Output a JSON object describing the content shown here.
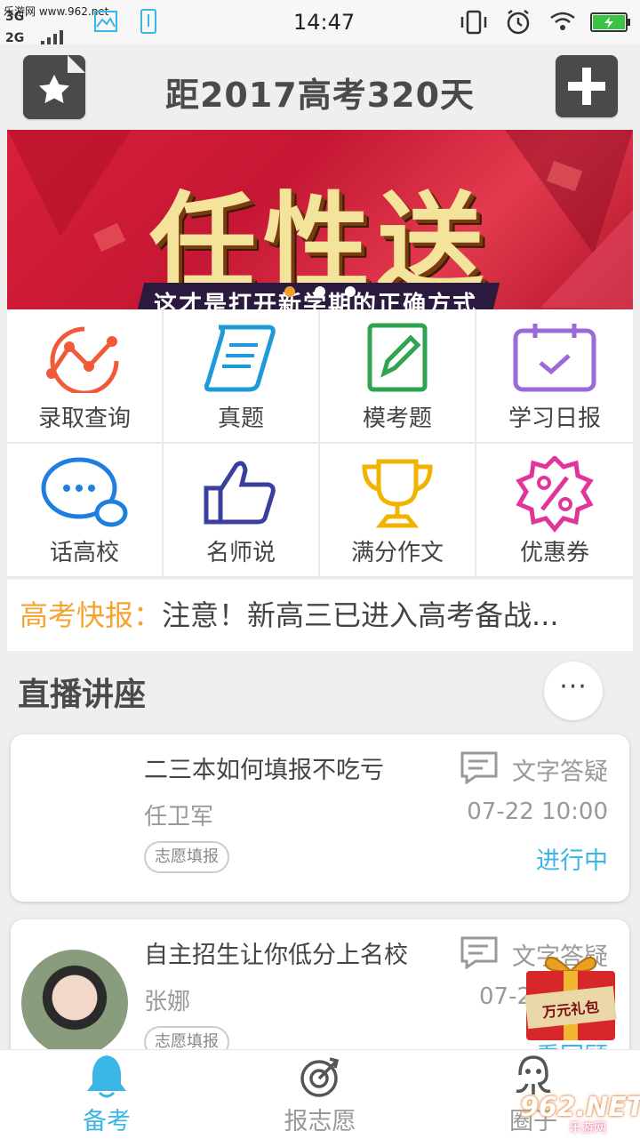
{
  "status_bar": {
    "watermark": "乐游网 www.962.net",
    "net_top": "3G",
    "net_bottom": "2G",
    "time": "14:47"
  },
  "header": {
    "title": "距2017高考320天"
  },
  "banner": {
    "headline": "任性送",
    "subline": "这才是打开新学期的正确方式"
  },
  "features": [
    {
      "label": "录取查询",
      "icon": "trend-chart-icon"
    },
    {
      "label": "真题",
      "icon": "scroll-icon"
    },
    {
      "label": "模考题",
      "icon": "edit-icon"
    },
    {
      "label": "学习日报",
      "icon": "calendar-check-icon"
    },
    {
      "label": "话高校",
      "icon": "chat-bubbles-icon"
    },
    {
      "label": "名师说",
      "icon": "thumbs-up-icon"
    },
    {
      "label": "满分作文",
      "icon": "trophy-icon"
    },
    {
      "label": "优惠券",
      "icon": "percent-badge-icon"
    }
  ],
  "news": {
    "tag": "高考快报：",
    "text": "注意！新高三已进入高考备战..."
  },
  "section": {
    "title": "直播讲座",
    "more": "···"
  },
  "lectures": [
    {
      "title": "二三本如何填报不吃亏",
      "author": "任卫军",
      "tag": "志愿填报",
      "type": "文字答疑",
      "time": "07-22 10:00",
      "status": "进行中"
    },
    {
      "title": "自主招生让你低分上名校",
      "author": "张娜",
      "tag": "志愿填报",
      "type": "文字答疑",
      "time": "07-2",
      "status": "看回顾"
    }
  ],
  "gift": {
    "label": "万元礼包"
  },
  "bottom_nav": [
    {
      "label": "备考",
      "active": true
    },
    {
      "label": "报志愿",
      "active": false
    },
    {
      "label": "圈子",
      "active": false
    }
  ],
  "watermark": {
    "big": "962.NET",
    "small": "乐游网"
  },
  "colors": {
    "accent": "#3ab6e6",
    "news_tag": "#f5a331",
    "header_btn": "#4a4a4a"
  }
}
